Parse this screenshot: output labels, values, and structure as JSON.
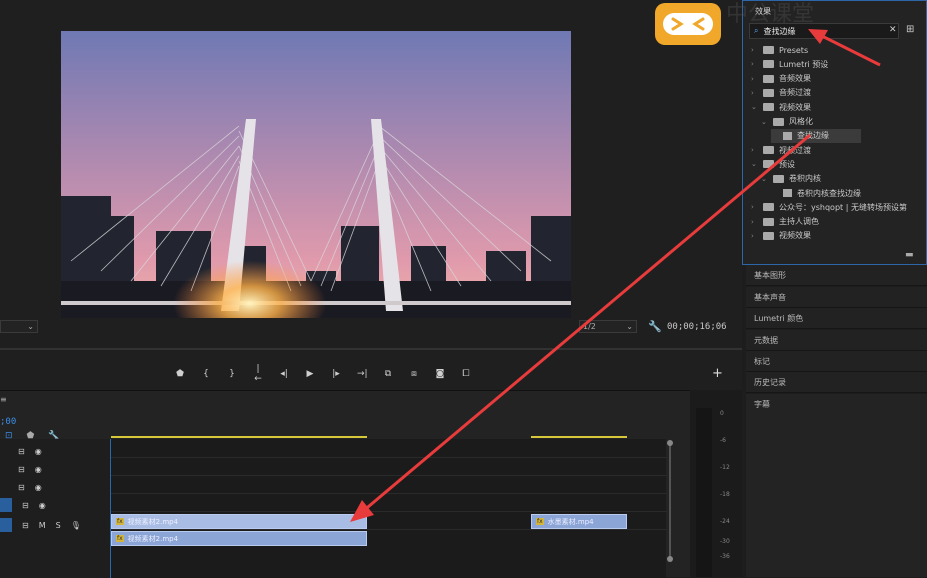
{
  "monitor": {
    "zoom_left": "",
    "resolution": "1/2",
    "timecode": "00;00;16;06",
    "controls": [
      "marker-icon",
      "in-icon",
      "out-icon",
      "go-to-in-icon",
      "step-back-icon",
      "play-icon",
      "step-forward-icon",
      "go-to-out-icon",
      "lift-icon",
      "extract-icon",
      "export-frame-icon",
      "comparison-icon"
    ],
    "plus": "+"
  },
  "timeline": {
    "time": ";00",
    "clips": [
      {
        "label": "视频素材2.mp4",
        "fx": "fx"
      },
      {
        "label": "视频素材2.mp4",
        "fx": "fx"
      },
      {
        "label": "水墨素材.mp4",
        "fx": "fx"
      }
    ],
    "track_labels": [
      "M",
      "S"
    ],
    "meter_ticks": [
      "0",
      "-6",
      "-12",
      "-18",
      "-24",
      "-30",
      "-36"
    ]
  },
  "effects": {
    "title": "效果",
    "search_value": "查找边缘",
    "tree": [
      {
        "label": "Presets",
        "indent": 0,
        "kind": "folder",
        "chev": "›"
      },
      {
        "label": "Lumetri 预设",
        "indent": 0,
        "kind": "folder",
        "chev": "›"
      },
      {
        "label": "音频效果",
        "indent": 0,
        "kind": "folder",
        "chev": "›"
      },
      {
        "label": "音频过渡",
        "indent": 0,
        "kind": "folder",
        "chev": "›"
      },
      {
        "label": "视频效果",
        "indent": 0,
        "kind": "folder",
        "chev": "⌄"
      },
      {
        "label": "风格化",
        "indent": 1,
        "kind": "folder",
        "chev": "⌄"
      },
      {
        "label": "查找边缘",
        "indent": 2,
        "kind": "effect",
        "chev": ""
      },
      {
        "label": "视频过渡",
        "indent": 0,
        "kind": "folder",
        "chev": "›"
      },
      {
        "label": "预设",
        "indent": 0,
        "kind": "folder",
        "chev": "⌄"
      },
      {
        "label": "卷积内核",
        "indent": 1,
        "kind": "folder",
        "chev": "⌄"
      },
      {
        "label": "卷积内核查找边缘",
        "indent": 2,
        "kind": "effect",
        "chev": ""
      },
      {
        "label": "公众号：yshqopt | 无缝转场预设第",
        "indent": 0,
        "kind": "folder",
        "chev": "›"
      },
      {
        "label": "主持人调色",
        "indent": 0,
        "kind": "folder",
        "chev": "›"
      },
      {
        "label": "视频效果",
        "indent": 0,
        "kind": "folder",
        "chev": "›"
      }
    ]
  },
  "panels": [
    "基本图形",
    "基本声音",
    "Lumetri 颜色",
    "元数据",
    "标记",
    "历史记录",
    "字幕"
  ],
  "watermark": {
    "text": "中公课堂"
  },
  "colors": {
    "accent": "#2d66a9",
    "arrow": "#e83b3b",
    "logo": "#f0a72a",
    "clip": "#8aa5d6"
  }
}
